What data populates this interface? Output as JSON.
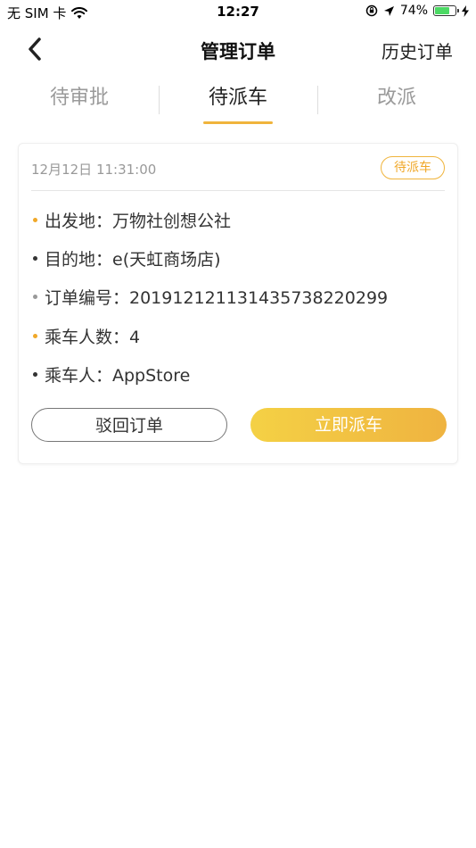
{
  "status_bar": {
    "carrier": "无 SIM 卡",
    "time": "12:27",
    "battery_percent": "74%",
    "battery_level": 0.74,
    "icons": [
      "wifi-icon",
      "orientation-lock-icon",
      "location-arrow-icon",
      "battery-icon",
      "charging-bolt-icon"
    ]
  },
  "nav": {
    "title": "管理订单",
    "right_link": "历史订单",
    "back_icon": "chevron-left-icon"
  },
  "tabs": [
    {
      "label": "待审批",
      "active": false
    },
    {
      "label": "待派车",
      "active": true
    },
    {
      "label": "改派",
      "active": false
    }
  ],
  "order": {
    "time": "12月12日 11:31:00",
    "status": "待派车",
    "rows": [
      {
        "text": "出发地：万物社创想公社",
        "bullet_color": "#f0a829"
      },
      {
        "text": "目的地：e(天虹商场店)",
        "bullet_color": "#333333"
      },
      {
        "text": "订单编号：20191212113143573822029​9",
        "bullet_color": "#999999"
      },
      {
        "text": "乘车人数：4",
        "bullet_color": "#f0a829"
      },
      {
        "text": "乘车人：AppStore",
        "bullet_color": "#333333"
      }
    ],
    "reject_label": "驳回订单",
    "dispatch_label": "立即派车"
  },
  "colors": {
    "accent": "#f0b43c",
    "gradient_start": "#f4d145",
    "gradient_end": "#efb340"
  }
}
